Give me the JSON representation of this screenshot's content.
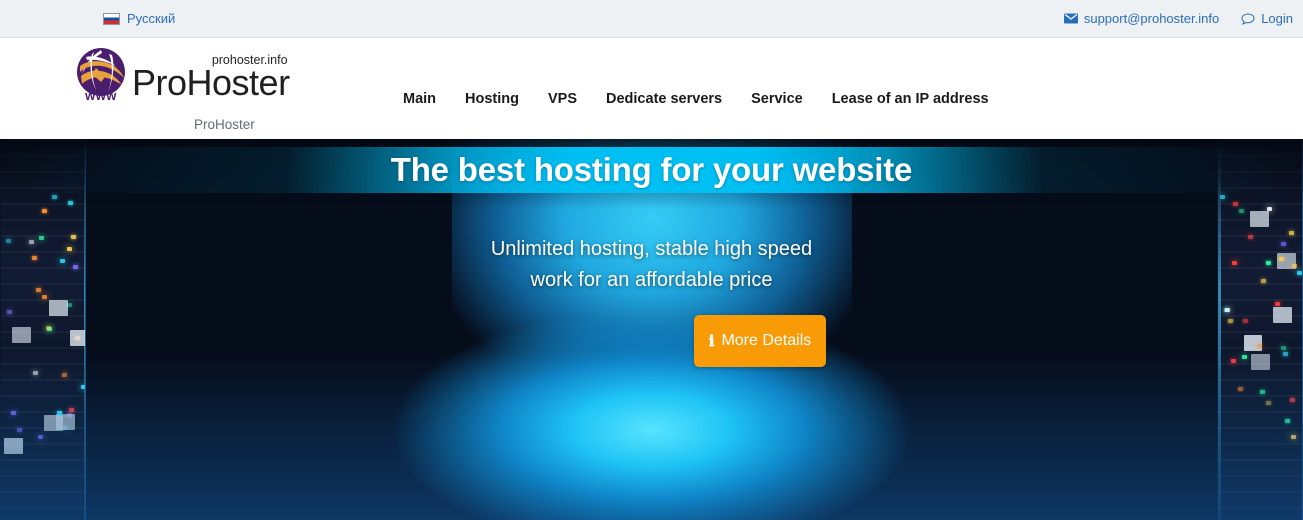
{
  "topbar": {
    "language": {
      "label": "Русский",
      "icon": "russian-flag-icon"
    },
    "email": {
      "label": "support@prohoster.info",
      "icon": "envelope-icon"
    },
    "login": {
      "label": "Login",
      "icon": "comment-bubble-icon"
    }
  },
  "header": {
    "logo": {
      "sub": "prohoster.info",
      "main": "ProHoster",
      "globe_text": "www",
      "colors": {
        "purple": "#4b1d6e",
        "orange": "#e8a13c"
      }
    },
    "nav": [
      {
        "label": "Main"
      },
      {
        "label": "Hosting"
      },
      {
        "label": "VPS"
      },
      {
        "label": "Dedicate servers"
      },
      {
        "label": "Service"
      },
      {
        "label": "Lease of an IP address"
      }
    ]
  },
  "breadcrumb": {
    "label": "ProHoster"
  },
  "hero": {
    "title": "The best hosting for your website",
    "subtitle_line1": "Unlimited hosting, stable high speed",
    "subtitle_line2": "work for an affordable price",
    "cta": {
      "label": "More Details",
      "icon": "info-icon"
    },
    "accent_color": "#00bff3",
    "cta_color": "#f99b06"
  }
}
